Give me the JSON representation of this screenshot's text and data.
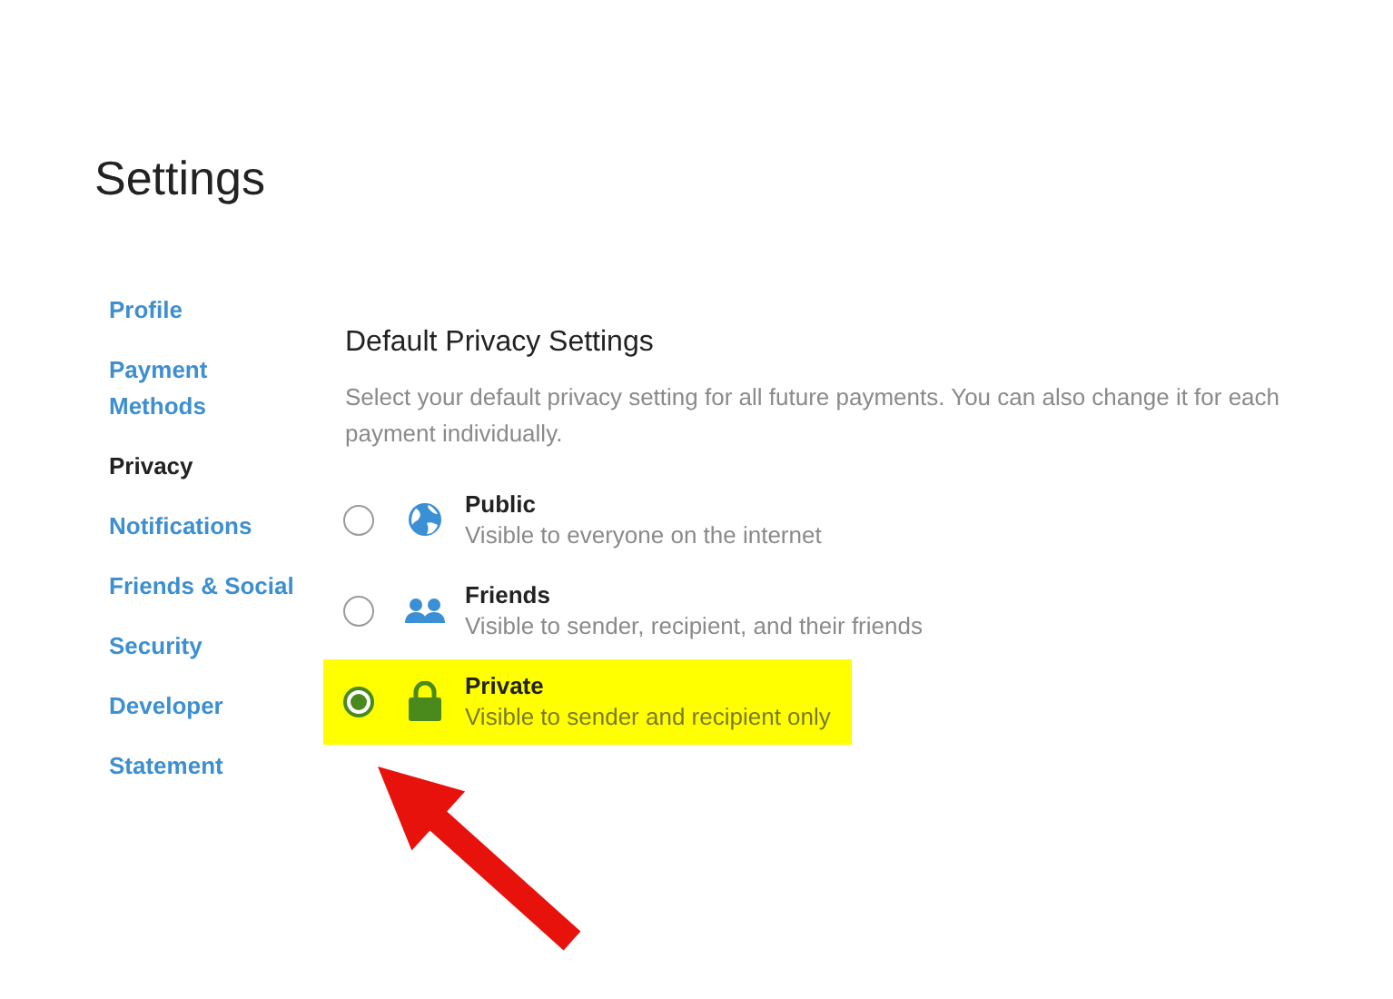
{
  "title": "Settings",
  "sidebar": {
    "items": [
      {
        "label": "Profile",
        "selected": false
      },
      {
        "label": "Payment Methods",
        "selected": false
      },
      {
        "label": "Privacy",
        "selected": true
      },
      {
        "label": "Notifications",
        "selected": false
      },
      {
        "label": "Friends & Social",
        "selected": false
      },
      {
        "label": "Security",
        "selected": false
      },
      {
        "label": "Developer",
        "selected": false
      },
      {
        "label": "Statement",
        "selected": false
      }
    ]
  },
  "section": {
    "heading": "Default Privacy Settings",
    "description": "Select your default privacy setting for all future payments. You can also change it for each payment individually.",
    "options": [
      {
        "kind": "globe",
        "title": "Public",
        "subtitle": "Visible to everyone on the internet",
        "selected": false,
        "highlighted": false
      },
      {
        "kind": "people",
        "title": "Friends",
        "subtitle": "Visible to sender, recipient, and their friends",
        "selected": false,
        "highlighted": false
      },
      {
        "kind": "lock",
        "title": "Private",
        "subtitle": "Visible to sender and recipient only",
        "selected": true,
        "highlighted": true
      }
    ]
  },
  "annotation": {
    "kind": "arrow"
  }
}
